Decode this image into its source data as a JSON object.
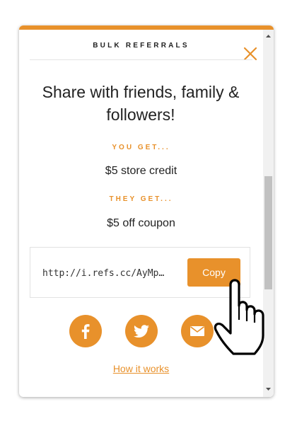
{
  "header": {
    "title": "BULK REFERRALS"
  },
  "main": {
    "headline": "Share with friends, family & followers!",
    "you_get": {
      "label": "YOU GET...",
      "value": "$5 store credit"
    },
    "they_get": {
      "label": "THEY GET...",
      "value": "$5 off coupon"
    },
    "referral_link": {
      "value": "http://i.refs.cc/AyMp…",
      "copy_label": "Copy"
    },
    "share_icons": [
      "facebook-icon",
      "twitter-icon",
      "email-icon"
    ],
    "how_it_works": "How it works"
  },
  "colors": {
    "accent": "#e8912b",
    "text": "#222222",
    "border": "#e2e2e2"
  }
}
